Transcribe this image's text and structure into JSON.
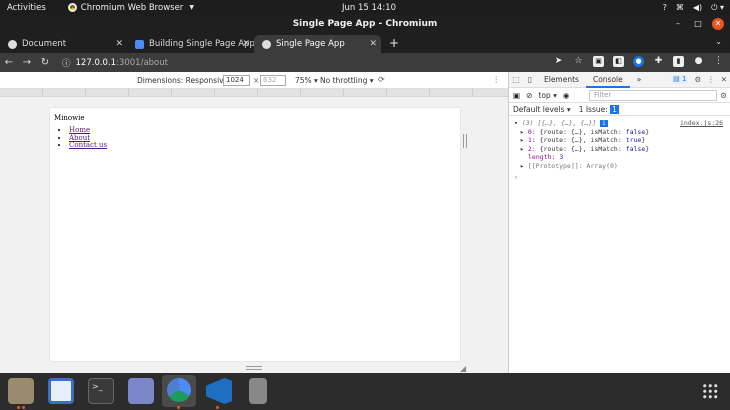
{
  "topbar": {
    "activities": "Activities",
    "app_name": "Chromium Web Browser",
    "clock": "Jun 15  14:10"
  },
  "window": {
    "title": "Single Page App - Chromium"
  },
  "tabs": [
    {
      "label": "Document"
    },
    {
      "label": "Building Single Page App"
    },
    {
      "label": "Single Page App"
    }
  ],
  "omnibox": {
    "host": "127.0.0.1",
    "path": ":3001/about"
  },
  "device_toolbar": {
    "dimensions_label": "Dimensions: Responsive",
    "width": "1024",
    "times": "×",
    "height_placeholder": "632",
    "zoom": "75%",
    "throttling": "No throttling"
  },
  "page": {
    "brand": "Minowie",
    "links": [
      "Home",
      "About",
      "Contact us"
    ]
  },
  "devtools": {
    "tabs": {
      "elements": "Elements",
      "console": "Console",
      "more": "»"
    },
    "issues_count": "1",
    "context": "top",
    "filter_placeholder": "Filter",
    "default_levels": "Default levels",
    "issue_label": "1 Issue:",
    "issue_count": "1",
    "console": {
      "array_summary": "(3) [{…}, {…}, {…}]",
      "info_badge": "i",
      "source": "index.js:26",
      "items": [
        {
          "key": "0:",
          "body": "{route: {…}, isMatch: ",
          "val": "false",
          "end": "}"
        },
        {
          "key": "1:",
          "body": "{route: {…}, isMatch: ",
          "val": "true",
          "end": "}"
        },
        {
          "key": "2:",
          "body": "{route: {…}, isMatch: ",
          "val": "false",
          "end": "}"
        }
      ],
      "length_key": "length:",
      "length_val": "3",
      "prototype": "[[Prototype]]: Array(0)"
    }
  }
}
